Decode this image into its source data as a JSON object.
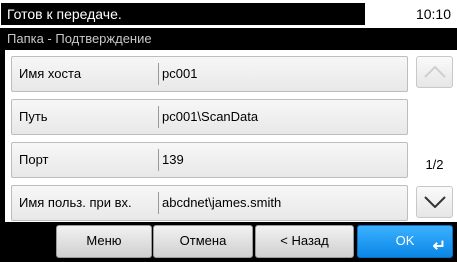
{
  "status": {
    "message": "Готов к передаче.",
    "time": "10:10"
  },
  "screen_title": "Папка - Подтверждение",
  "rows": [
    {
      "label": "Имя хоста",
      "value": "pc001"
    },
    {
      "label": "Путь",
      "value": "pc001\\ScanData"
    },
    {
      "label": "Порт",
      "value": "139"
    },
    {
      "label": "Имя польз. при вх.",
      "value": "abcdnet\\james.smith"
    }
  ],
  "pager": {
    "indicator": "1/2",
    "up_icon": "chevron-up-icon",
    "down_icon": "chevron-down-icon"
  },
  "buttons": {
    "menu": "Меню",
    "cancel": "Отмена",
    "back": "< Назад",
    "ok": "OK"
  },
  "colors": {
    "ok_button": "#1a98f3",
    "background": "#000000"
  }
}
